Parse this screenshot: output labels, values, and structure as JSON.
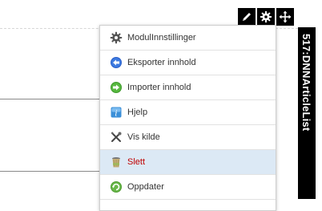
{
  "module": {
    "title": "517:DNNArticleList"
  },
  "actions": [
    {
      "name": "edit-icon"
    },
    {
      "name": "gear-icon"
    },
    {
      "name": "move-icon"
    }
  ],
  "menu": {
    "items": [
      {
        "label": "ModulInnstillinger",
        "icon": "gear-icon"
      },
      {
        "label": "Eksporter innhold",
        "icon": "export-icon"
      },
      {
        "label": "Importer innhold",
        "icon": "import-icon"
      },
      {
        "label": "Hjelp",
        "icon": "help-icon"
      },
      {
        "label": "Vis kilde",
        "icon": "tools-icon"
      },
      {
        "label": "Slett",
        "icon": "trash-icon"
      },
      {
        "label": "Oppdater",
        "icon": "refresh-icon"
      }
    ]
  },
  "colors": {
    "danger": "#c00000",
    "highlight": "#dce9f5",
    "bar": "#000000"
  }
}
